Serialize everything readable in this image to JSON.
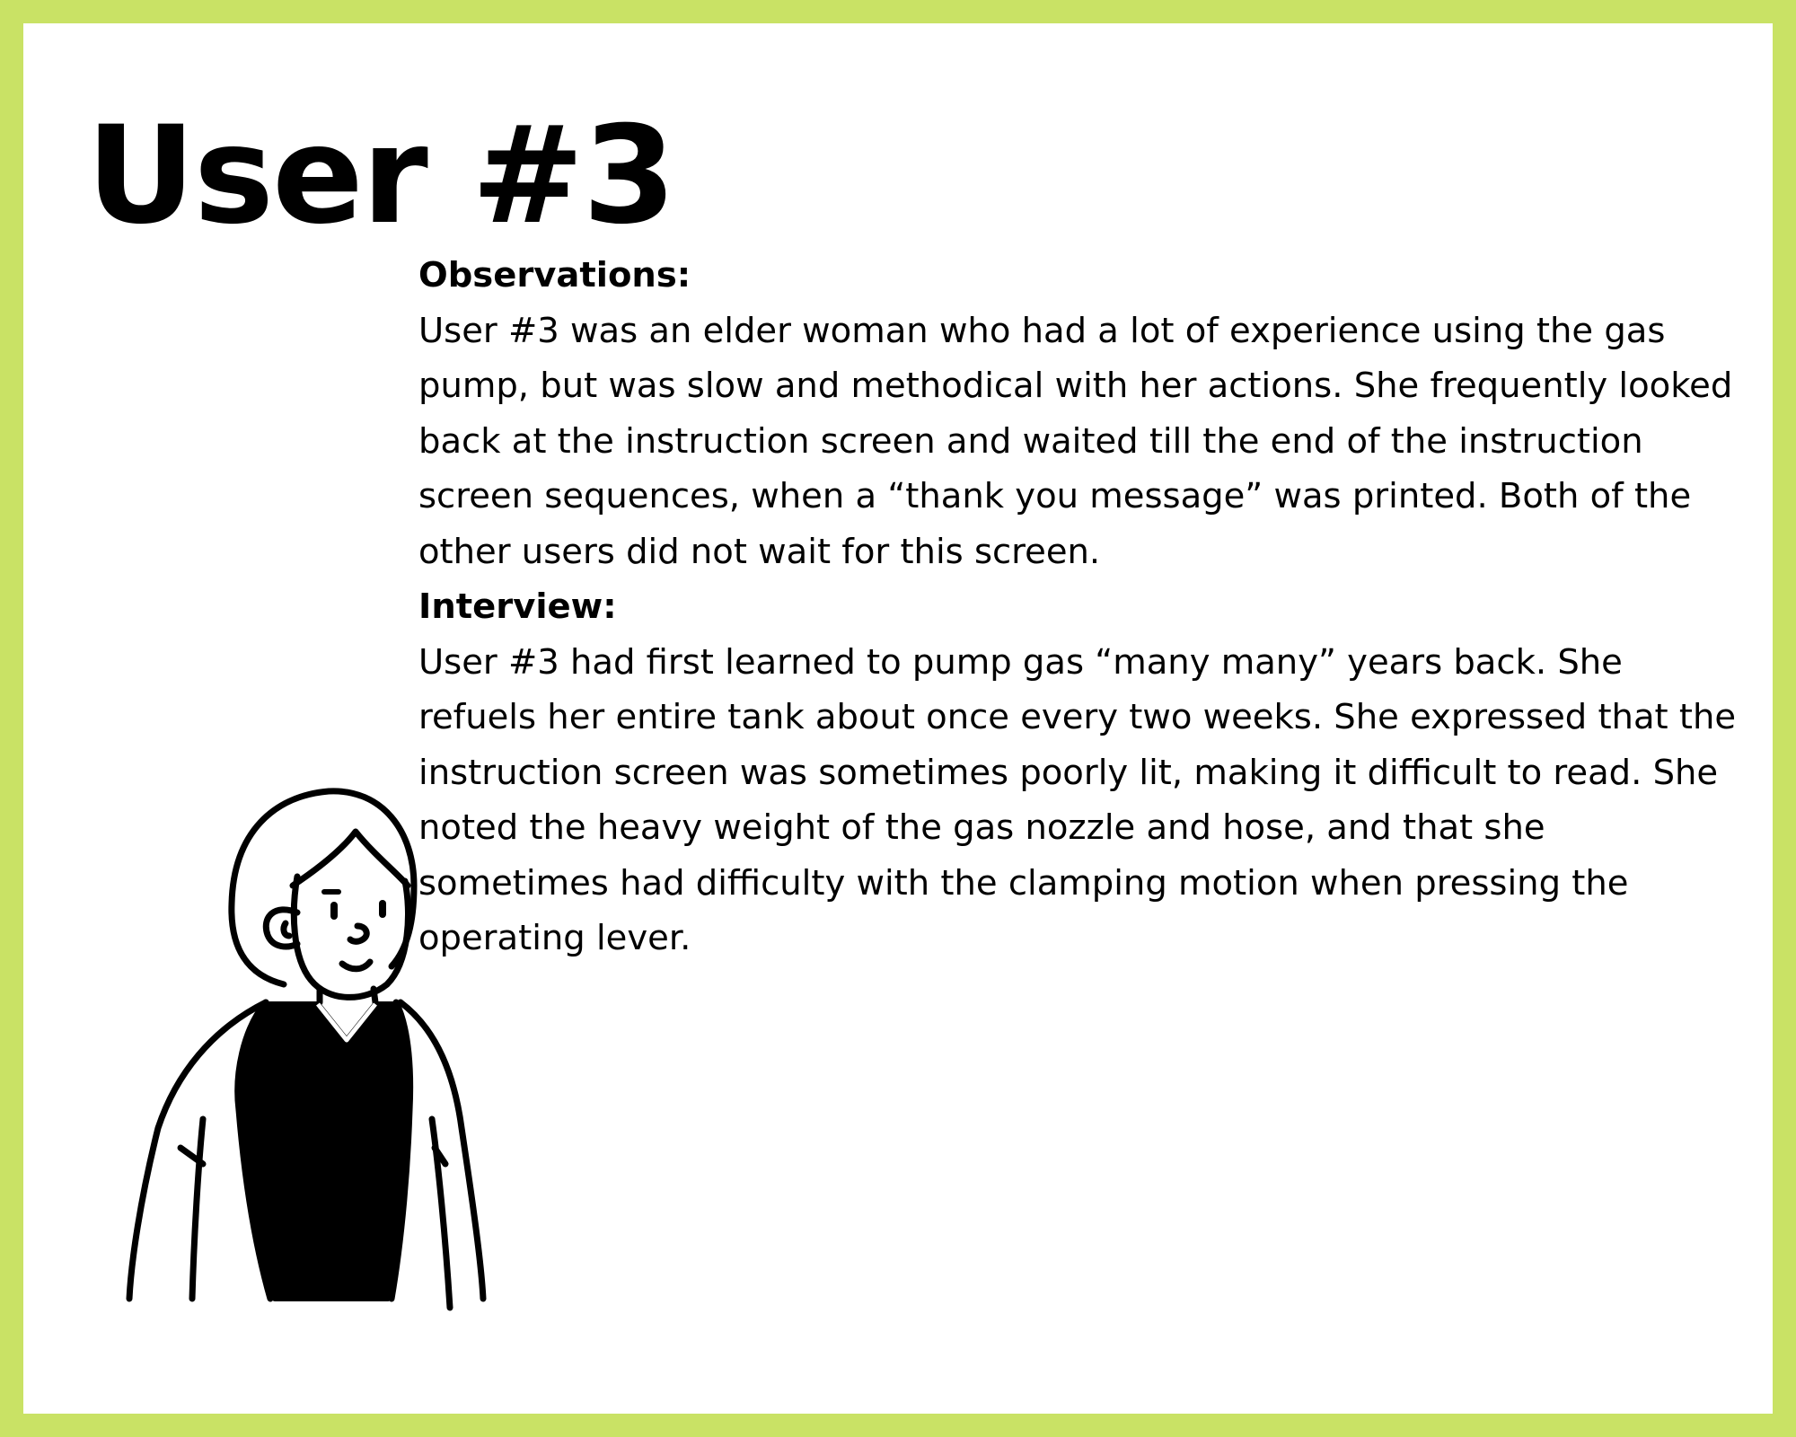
{
  "page": {
    "title": "User #3",
    "border_color": "#c9e265",
    "background_color": "#ffffff"
  },
  "observations": {
    "heading": "Observations:",
    "text": "User #3 was an elder woman who had a lot of experience using the gas pump, but was slow and methodical with her actions. She frequently looked back at the instruction screen and waited till the end of the instruction screen sequences, when a “thank you message” was printed. Both of the other users did not wait for this screen."
  },
  "interview": {
    "heading": "Interview:",
    "text": "User #3 had first learned to pump gas “many many” years back. She refuels her entire tank about once every two weeks. She expressed that the instruction screen was sometimes poorly lit, making it difficult to read. She noted the heavy weight of the gas nozzle and hose, and that she sometimes had difficulty with the clamping motion when pressing the operating lever."
  },
  "illustration": {
    "icon": "elderly-woman-icon"
  }
}
